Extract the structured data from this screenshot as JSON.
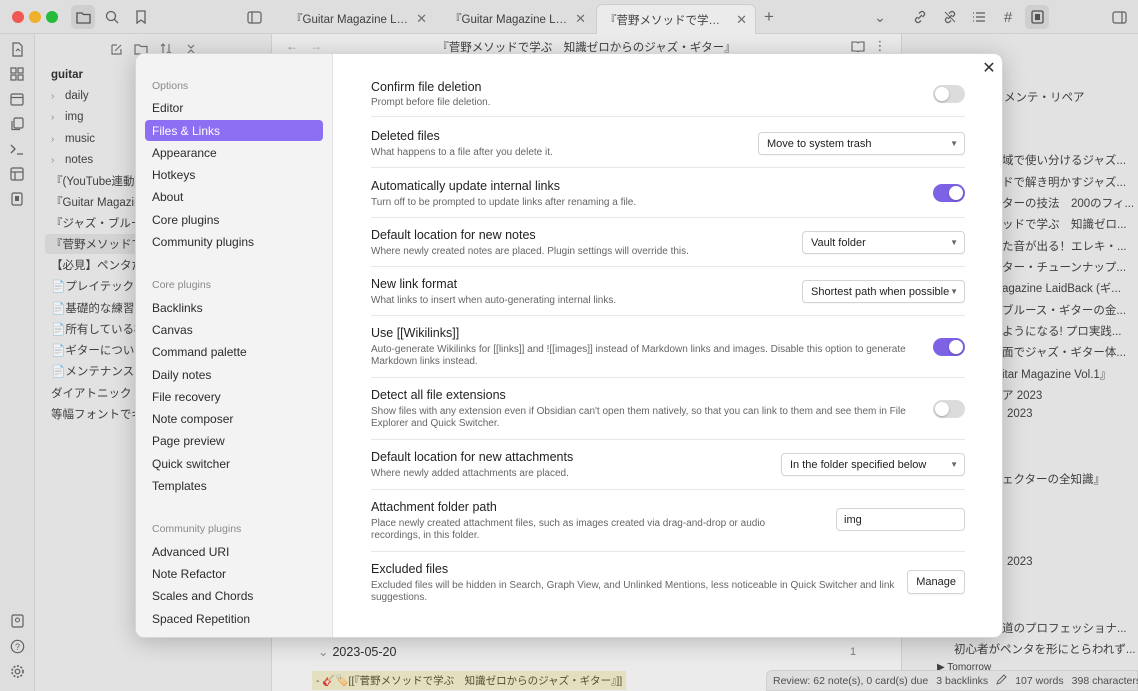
{
  "tabs": [
    {
      "label": "『Guitar Magazine LaidB...",
      "close": "✕"
    },
    {
      "label": "『Guitar Magazine LaidB...",
      "close": "✕"
    },
    {
      "label": "『菅野メソッドで学ぶ　...",
      "close": "✕"
    }
  ],
  "new_tab": "+",
  "tab_dropdown": "⌄",
  "editor": {
    "title": "『菅野メソッドで学ぶ　知識ゼロからのジャズ・ギター』",
    "date_heading": "2023-05-20",
    "date_count": "1",
    "bottom_link": "- 🎸🏷️[[『菅野メソッドで学ぶ　知識ゼロからのジャズ・ギター』]]"
  },
  "explorer": {
    "vault": "guitar",
    "items": [
      {
        "label": "daily",
        "folder": true
      },
      {
        "label": "img",
        "folder": true
      },
      {
        "label": "music",
        "folder": true
      },
      {
        "label": "notes",
        "folder": true
      },
      {
        "label": "『(YouTube連動)",
        "folder": false
      },
      {
        "label": "『Guitar Magazine",
        "folder": false
      },
      {
        "label": "『ジャズ・ブルー",
        "folder": false
      },
      {
        "label": "『菅野メソッドで",
        "folder": false
      },
      {
        "label": "【必見】ペンタだ",
        "folder": false
      },
      {
        "label": "📄プレイテックギ",
        "folder": false
      },
      {
        "label": "📄基礎的な練習",
        "folder": false
      },
      {
        "label": "📄所有している機",
        "folder": false
      },
      {
        "label": "📄ギターについて",
        "folder": false
      },
      {
        "label": "📄メンテナンスの",
        "folder": false
      },
      {
        "label": "ダイアトニック・",
        "folder": false
      },
      {
        "label": "等幅フォントでギ",
        "folder": false
      }
    ]
  },
  "rightbar": {
    "items": [
      "メンテ・リペア",
      "域で使い分けるジャズ...",
      "ドで解き明かすジャズ...",
      "ターの技法　200のフィ...",
      "ッドで学ぶ　知識ゼロ...",
      "た音が出る！エレキ・...",
      "ター・チューンナップ...",
      "agazine LaidBack (ギ...",
      "ブルース・ギターの金...",
      "ようになる! プロ実践...",
      "面でジャズ・ギター体...",
      "itar Magazine Vol.1』",
      "ア 2023",
      "2023",
      "ェクターの全知識』",
      "2023",
      "道のプロフェッショナ...",
      "初心者がペンタを形にとらわれず...",
      "▶ Tomorrow"
    ]
  },
  "statusbar": {
    "review": "Review: 62 note(s), 0 card(s) due",
    "backlinks": "3 backlinks",
    "words": "107 words",
    "characters": "398 characters"
  },
  "modal": {
    "close": "✕",
    "sidebar": {
      "options_header": "Options",
      "options": [
        "Editor",
        "Files & Links",
        "Appearance",
        "Hotkeys",
        "About",
        "Core plugins",
        "Community plugins"
      ],
      "active": "Files & Links",
      "core_header": "Core plugins",
      "core": [
        "Backlinks",
        "Canvas",
        "Command palette",
        "Daily notes",
        "File recovery",
        "Note composer",
        "Page preview",
        "Quick switcher",
        "Templates"
      ],
      "community_header": "Community plugins",
      "community": [
        "Advanced URI",
        "Note Refactor",
        "Scales and Chords",
        "Spaced Repetition"
      ]
    },
    "settings": [
      {
        "name": "Confirm file deletion",
        "desc": "Prompt before file deletion.",
        "control": "toggle",
        "on": false
      },
      {
        "name": "Deleted files",
        "desc": "What happens to a file after you delete it.",
        "control": "dropdown",
        "value": "Move to system trash"
      },
      {
        "name": "Automatically update internal links",
        "desc": "Turn off to be prompted to update links after renaming a file.",
        "control": "toggle",
        "on": true
      },
      {
        "name": "Default location for new notes",
        "desc": "Where newly created notes are placed. Plugin settings will override this.",
        "control": "dropdown",
        "value": "Vault folder"
      },
      {
        "name": "New link format",
        "desc": "What links to insert when auto-generating internal links.",
        "control": "dropdown",
        "value": "Shortest path when possible"
      },
      {
        "name": "Use [[Wikilinks]]",
        "desc": "Auto-generate Wikilinks for [[links]] and ![[images]] instead of Markdown links and images. Disable this option to generate Markdown links instead.",
        "control": "toggle",
        "on": true
      },
      {
        "name": "Detect all file extensions",
        "desc": "Show files with any extension even if Obsidian can't open them natively, so that you can link to them and see them in File Explorer and Quick Switcher.",
        "control": "toggle",
        "on": false
      },
      {
        "name": "Default location for new attachments",
        "desc": "Where newly added attachments are placed.",
        "control": "dropdown",
        "value": "In the folder specified below"
      },
      {
        "name": "Attachment folder path",
        "desc": "Place newly created attachment files, such as images created via drag-and-drop or audio recordings, in this folder.",
        "control": "text",
        "value": "img"
      },
      {
        "name": "Excluded files",
        "desc": "Excluded files will be hidden in Search, Graph View, and Unlinked Mentions, less noticeable in Quick Switcher and link suggestions.",
        "control": "button",
        "value": "Manage"
      }
    ]
  },
  "colors": {
    "accent": "#8c6ff2",
    "toggle_on": "#7e62e6",
    "toggle_off": "#dcdcdc"
  }
}
